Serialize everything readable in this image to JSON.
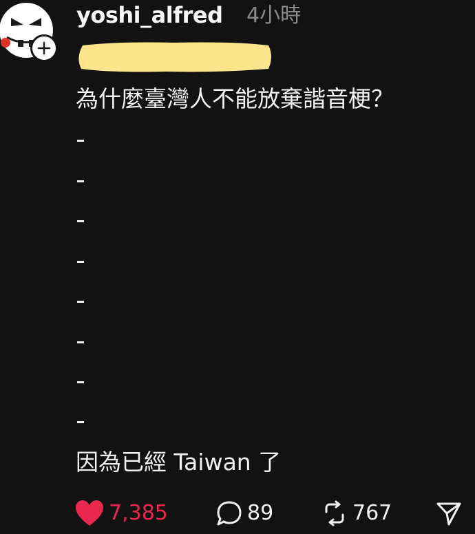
{
  "post": {
    "username": "yoshi_alfred",
    "timestamp": "4小時",
    "lines": [
      "為什麼臺灣人不能放棄諧音梗？",
      "因為已經 Taiwan 了"
    ],
    "dashes": [
      "-",
      "-",
      "-",
      "-",
      "-",
      "-",
      "-",
      "-"
    ]
  },
  "actions": {
    "likes": "7,385",
    "comments": "89",
    "reposts": "767"
  },
  "colors": {
    "background": "#121212",
    "like": "#e8284f",
    "highlight": "#fce58a",
    "muted": "#8a8a8a"
  },
  "icons": {
    "avatar": "cartoon-face-avatar",
    "follow": "plus-icon",
    "like": "heart-icon",
    "comment": "comment-bubble-icon",
    "repost": "repost-icon",
    "share": "send-icon"
  }
}
